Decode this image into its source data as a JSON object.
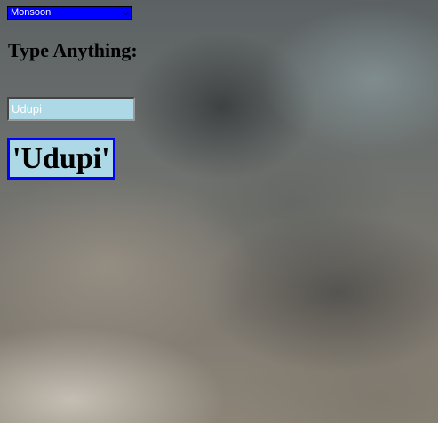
{
  "season_select": {
    "selected": "Monsoon",
    "icon": "chevron-down-icon"
  },
  "heading": "Type Anything:",
  "text_input": {
    "value": "Udupi"
  },
  "output": {
    "text": "'Udupi'"
  },
  "colors": {
    "select_bg": "#0000ff",
    "select_text": "#ffffff",
    "input_bg": "#add8e6",
    "input_text": "#ffffff",
    "output_border": "#0000ff",
    "output_bg": "#add8e6"
  }
}
